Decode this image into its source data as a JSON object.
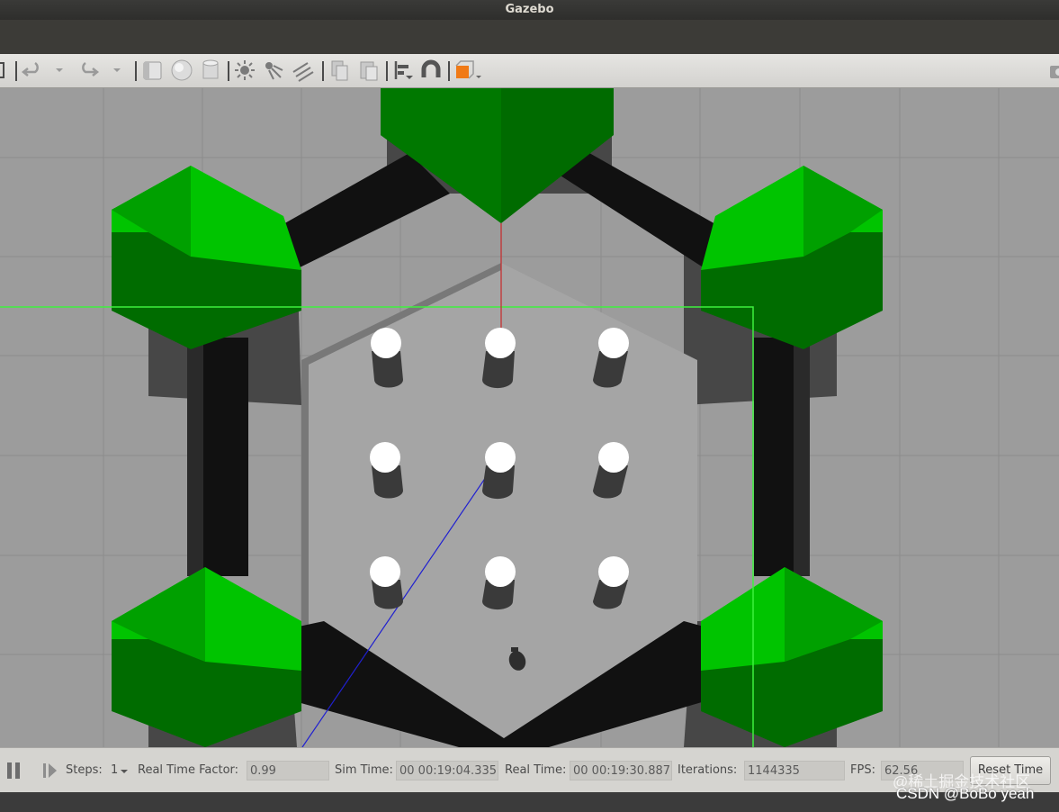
{
  "window": {
    "title": "Gazebo"
  },
  "toolbar": {
    "tools": [
      "translate-tool",
      "undo-icon",
      "undo-dropdown-icon",
      "redo-icon",
      "redo-dropdown-icon",
      "box-icon",
      "sphere-icon",
      "cylinder-icon",
      "point-light-icon",
      "spot-light-icon",
      "directional-light-icon",
      "copy-icon",
      "paste-icon",
      "align-icon",
      "snap-icon",
      "view-angle-icon",
      "screenshot-icon"
    ],
    "accent_color": "#f07a16"
  },
  "scene": {
    "colors": {
      "ground": "#9c9c9c",
      "floor": "#a7a7a7",
      "wall": "#111111",
      "pillar_top": "#00c800",
      "pillar_side": "#006a00",
      "cylinder": "#ffffff"
    }
  },
  "bottom_bar": {
    "steps_label": "Steps:",
    "steps_value": "1",
    "rtf_label": "Real Time Factor:",
    "rtf_value": "0.99",
    "sim_time_label": "Sim Time:",
    "sim_time_value": "00 00:19:04.335",
    "real_time_label": "Real Time:",
    "real_time_value": "00 00:19:30.887",
    "iterations_label": "Iterations:",
    "iterations_value": "1144335",
    "fps_label": "FPS:",
    "fps_value": "62.56",
    "reset_label": "Reset Time"
  },
  "watermark": {
    "line1": "@稀土掘金技术社区",
    "line2": "CSDN @BoBo yeah"
  }
}
